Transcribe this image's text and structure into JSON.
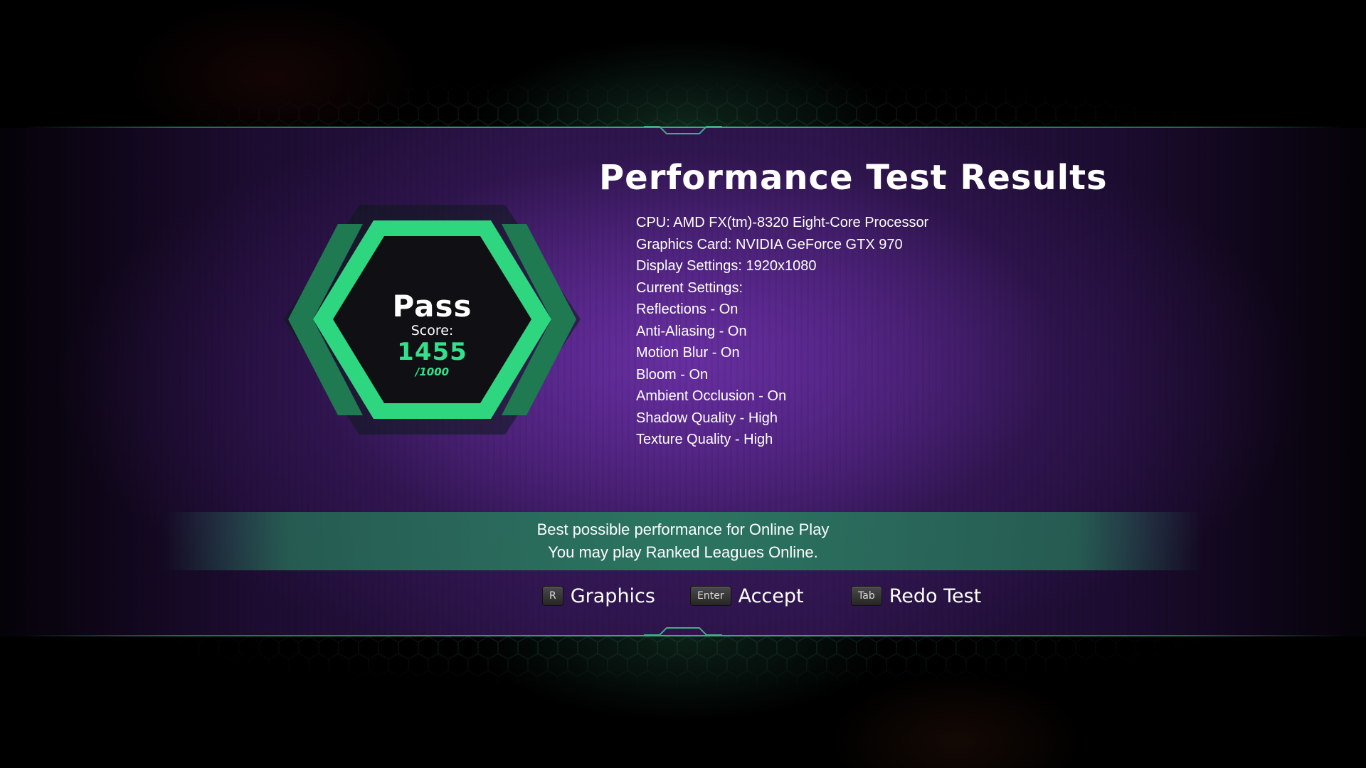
{
  "title": "Performance Test Results",
  "result": {
    "status": "Pass",
    "score_label": "Score:",
    "score": "1455",
    "score_max": "/1000"
  },
  "specs": {
    "cpu": "CPU: AMD FX(tm)-8320 Eight-Core Processor",
    "gpu": "Graphics Card: NVIDIA GeForce GTX 970",
    "display": "Display Settings: 1920x1080",
    "current_settings": "Current Settings:",
    "settings": [
      "Reflections - On",
      "Anti-Aliasing - On",
      "Motion Blur - On",
      "Bloom - On",
      "Ambient Occlusion - On",
      "Shadow Quality - High",
      "Texture Quality - High"
    ]
  },
  "message": {
    "line1": "Best possible performance for Online Play",
    "line2": "You may play Ranked Leagues Online."
  },
  "actions": [
    {
      "key": "R",
      "label": "Graphics"
    },
    {
      "key": "Enter",
      "label": "Accept"
    },
    {
      "key": "Tab",
      "label": "Redo Test"
    }
  ],
  "colors": {
    "accent_green": "#35e08c",
    "panel_purple": "#2b1447",
    "bar_teal": "#2b7560"
  }
}
